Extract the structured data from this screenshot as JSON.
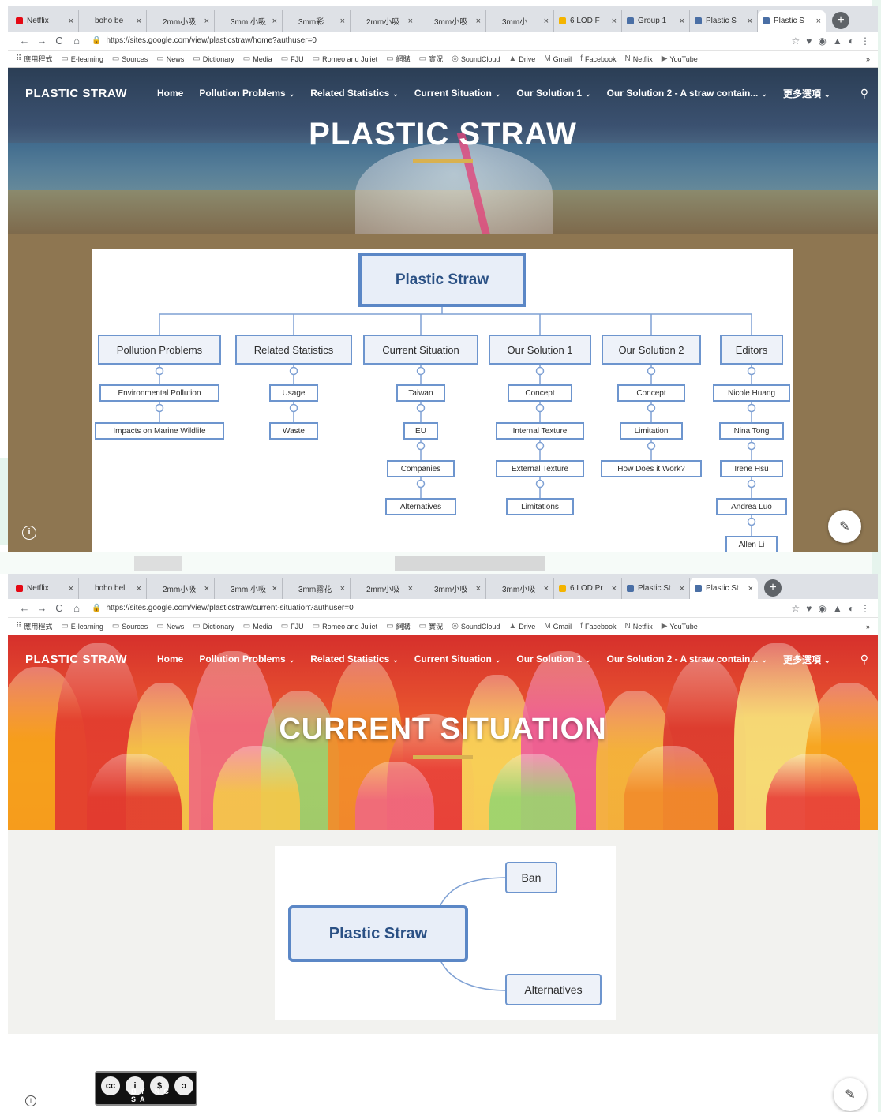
{
  "colors": {
    "accent_gold": "#d8b150",
    "node_border": "#6d95ce",
    "root_text": "#2b5185",
    "content_bg_home": "#8e7651",
    "content_bg_current": "#f2f2ef"
  },
  "browser": {
    "tabs_home": [
      {
        "label": "Netflix",
        "color": "#e50914"
      },
      {
        "label": "boho be",
        "color": "#dee1e6"
      },
      {
        "label": "2mm小吸",
        "color": "#dee1e6"
      },
      {
        "label": "3mm 小吸",
        "color": "#dee1e6"
      },
      {
        "label": "3mm彩",
        "color": "#dee1e6"
      },
      {
        "label": "2mm小吸",
        "color": "#dee1e6"
      },
      {
        "label": "3mm小吸",
        "color": "#dee1e6"
      },
      {
        "label": "3mm小",
        "color": "#dee1e6"
      },
      {
        "label": "6 LOD F",
        "color": "#f4b400"
      },
      {
        "label": "Group 1",
        "color": "#4a6fa5"
      },
      {
        "label": "Plastic S",
        "color": "#4a6fa5"
      },
      {
        "label": "Plastic S",
        "color": "#4a6fa5",
        "active": true
      }
    ],
    "tabs_current": [
      {
        "label": "Netflix",
        "color": "#e50914"
      },
      {
        "label": "boho bel",
        "color": "#dee1e6"
      },
      {
        "label": "2mm小吸",
        "color": "#dee1e6"
      },
      {
        "label": "3mm 小吸",
        "color": "#dee1e6"
      },
      {
        "label": "3mm霧花",
        "color": "#dee1e6"
      },
      {
        "label": "2mm小吸",
        "color": "#dee1e6"
      },
      {
        "label": "3mm小吸",
        "color": "#dee1e6"
      },
      {
        "label": "3mm小吸",
        "color": "#dee1e6"
      },
      {
        "label": "6 LOD Pr",
        "color": "#f4b400"
      },
      {
        "label": "Plastic St",
        "color": "#4a6fa5"
      },
      {
        "label": "Plastic St",
        "color": "#4a6fa5",
        "active": true
      }
    ],
    "tab_close": "×",
    "new_tab": "+",
    "url_home": "https://sites.google.com/view/plasticstraw/home?authuser=0",
    "url_current": "https://sites.google.com/view/plasticstraw/current-situation?authuser=0",
    "nav_back": "←",
    "nav_forward": "→",
    "nav_reload": "C",
    "nav_home": "⌂",
    "lock": "🔒",
    "ext_icons": [
      "☆",
      "♥",
      "◉",
      "▲",
      "◐",
      "⋮"
    ],
    "bookmarks": [
      {
        "icon": "⠿",
        "label": "應用程式"
      },
      {
        "icon": "▭",
        "label": "E-learning"
      },
      {
        "icon": "▭",
        "label": "Sources"
      },
      {
        "icon": "▭",
        "label": "News"
      },
      {
        "icon": "▭",
        "label": "Dictionary"
      },
      {
        "icon": "▭",
        "label": "Media"
      },
      {
        "icon": "▭",
        "label": "FJU"
      },
      {
        "icon": "▭",
        "label": "Romeo and Juliet"
      },
      {
        "icon": "▭",
        "label": "網購"
      },
      {
        "icon": "▭",
        "label": "實況"
      },
      {
        "icon": "◎",
        "label": "SoundCloud"
      },
      {
        "icon": "▲",
        "label": "Drive"
      },
      {
        "icon": "M",
        "label": "Gmail"
      },
      {
        "icon": "f",
        "label": "Facebook"
      },
      {
        "icon": "N",
        "label": "Netflix"
      },
      {
        "icon": "▶",
        "label": "YouTube"
      }
    ],
    "bookmarks_more": "»"
  },
  "site": {
    "logo": "PLASTIC STRAW",
    "nav_home": [
      {
        "label": "Home",
        "caret": false
      },
      {
        "label": "Pollution Problems",
        "caret": true
      },
      {
        "label": "Related Statistics",
        "caret": true
      },
      {
        "label": "Current Situation",
        "caret": true
      },
      {
        "label": "Our Solution 1",
        "caret": true
      },
      {
        "label": "Our Solution 2 - A straw contain...",
        "caret": true
      },
      {
        "label": "更多選項",
        "caret": true
      }
    ],
    "nav_current": [
      {
        "label": "Home",
        "caret": false
      },
      {
        "label": "Pollution Problems",
        "caret": true
      },
      {
        "label": "Related Statistics",
        "caret": true
      },
      {
        "label": "Current Situation",
        "caret": true
      },
      {
        "label": "Our Solution 1",
        "caret": true
      },
      {
        "label": "Our Solution 2 - A straw contain...",
        "caret": true
      },
      {
        "label": "更多選項",
        "caret": true
      }
    ],
    "caret": "⌄",
    "search": "⚲",
    "info": "i",
    "edit": "✎"
  },
  "home": {
    "hero_title": "PLASTIC STRAW",
    "map": {
      "root": "Plastic Straw",
      "branches": [
        {
          "label": "Pollution Problems",
          "children": [
            "Environmental Pollution",
            "Impacts on Marine Wildlife"
          ]
        },
        {
          "label": "Related Statistics",
          "children": [
            "Usage",
            "Waste"
          ]
        },
        {
          "label": "Current Situation",
          "children": [
            "Taiwan",
            "EU",
            "Companies",
            "Alternatives"
          ]
        },
        {
          "label": "Our Solution 1",
          "children": [
            "Concept",
            "Internal Texture",
            "External Texture",
            "Limitations"
          ]
        },
        {
          "label": "Our Solution 2",
          "children": [
            "Concept",
            "Limitation",
            "How Does it Work?"
          ]
        },
        {
          "label": "Editors",
          "children": [
            "Nicole Huang",
            "Nina Tong",
            "Irene Hsu",
            "Andrea Luo",
            "Allen Li"
          ]
        }
      ]
    }
  },
  "current": {
    "hero_title": "CURRENT SITUATION",
    "map": {
      "root": "Plastic Straw",
      "children": [
        "Ban",
        "Alternatives"
      ]
    },
    "license": {
      "symbols": [
        "cc",
        "i",
        "$",
        "ↄ"
      ],
      "terms": "BY NC SA"
    }
  }
}
